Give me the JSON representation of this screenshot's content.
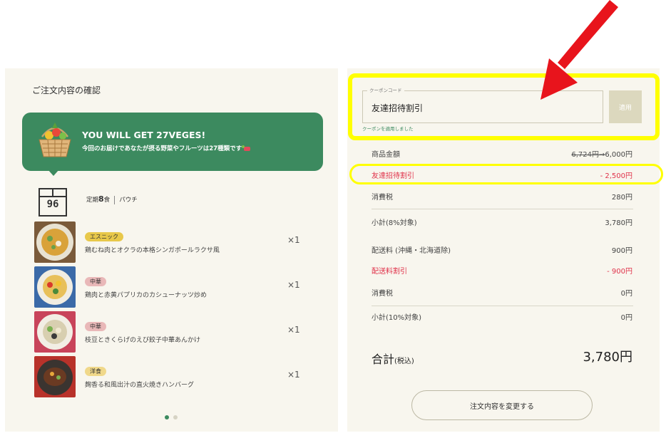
{
  "order": {
    "title": "ご注文内容の確認",
    "banner": {
      "title": "YOU WILL GET 27VEGES!",
      "subtitle": "今回のお届けであなたが摂る野菜やフルーツは27種類です"
    },
    "plan": {
      "box_number": "96",
      "prefix": "定期",
      "count": "8",
      "suffix": "食",
      "type": "パウチ"
    },
    "items": [
      {
        "tag": "エスニック",
        "tag_color": "#e8c84a",
        "name": "鶏むね肉とオクラの本格シンガポールラクサ風",
        "qty": "×1"
      },
      {
        "tag": "中華",
        "tag_color": "#e9b8b8",
        "name": "鶏肉と赤黄パプリカのカシューナッツ炒め",
        "qty": "×1"
      },
      {
        "tag": "中華",
        "tag_color": "#e9b8b8",
        "name": "枝豆ときくらげのえび餃子中華あんかけ",
        "qty": "×1"
      },
      {
        "tag": "洋食",
        "tag_color": "#f0d88a",
        "name": "麹香る和風出汁の直火焼きハンバーグ",
        "qty": "×1"
      }
    ]
  },
  "coupon": {
    "legend": "クーポンコード",
    "value": "友達招待割引",
    "apply_label": "適用",
    "message": "クーポンを適用しました"
  },
  "summary": {
    "product_label": "商品金額",
    "product_original": "6,724円",
    "product_price": "6,000円",
    "discount_label": "友達招待割引",
    "discount_value": "- 2,500円",
    "tax1_label": "消費税",
    "tax1_value": "280円",
    "subtotal1_label": "小計(8%対象)",
    "subtotal1_value": "3,780円",
    "shipping_label": "配送料 (沖縄・北海道除)",
    "shipping_value": "900円",
    "shipping_discount_label": "配送料割引",
    "shipping_discount_value": "- 900円",
    "tax2_label": "消費税",
    "tax2_value": "0円",
    "subtotal2_label": "小計(10%対象)",
    "subtotal2_value": "0円",
    "total_label": "合計",
    "total_tax_note": "(税込)",
    "total_value": "3,780円",
    "change_button": "注文内容を変更する"
  },
  "colors": {
    "banner_green": "#3c8a5f",
    "discount_red": "#e0324a",
    "highlight_yellow": "#ffff00",
    "arrow_red": "#e8141c",
    "panel_bg": "#f8f6ee"
  },
  "carousel": {
    "active_index": 0,
    "count": 2
  }
}
